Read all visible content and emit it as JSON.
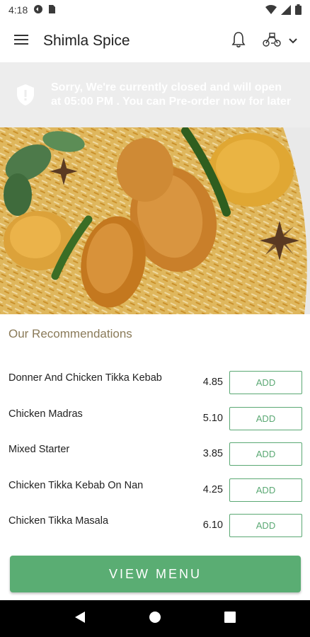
{
  "status_bar": {
    "time": "4:18"
  },
  "app_bar": {
    "title": "Shimla Spice"
  },
  "banner": {
    "message": "Sorry, We're currently closed and will open at 05:00 PM . You can Pre-order now for later"
  },
  "recommendations": {
    "title": "Our Recommendations",
    "items": [
      {
        "name": "Donner And Chicken Tikka Kebab",
        "price": "4.85",
        "button": "ADD"
      },
      {
        "name": "Chicken Madras",
        "price": "5.10",
        "button": "ADD"
      },
      {
        "name": "Mixed Starter",
        "price": "3.85",
        "button": "ADD"
      },
      {
        "name": "Chicken Tikka Kebab On Nan",
        "price": "4.25",
        "button": "ADD"
      },
      {
        "name": "Chicken Tikka Masala",
        "price": "6.10",
        "button": "ADD"
      }
    ]
  },
  "view_menu": {
    "label": "VIEW MENU"
  },
  "colors": {
    "accent": "#5aad73",
    "banner_bg": "#ededed",
    "section_title": "#8a7a58"
  },
  "icons": [
    "wifi-icon",
    "signal-icon",
    "battery-icon",
    "hamburger-icon",
    "bell-icon",
    "delivery-icon",
    "chevron-down-icon",
    "shield-icon",
    "back-icon",
    "home-icon",
    "recents-icon"
  ]
}
